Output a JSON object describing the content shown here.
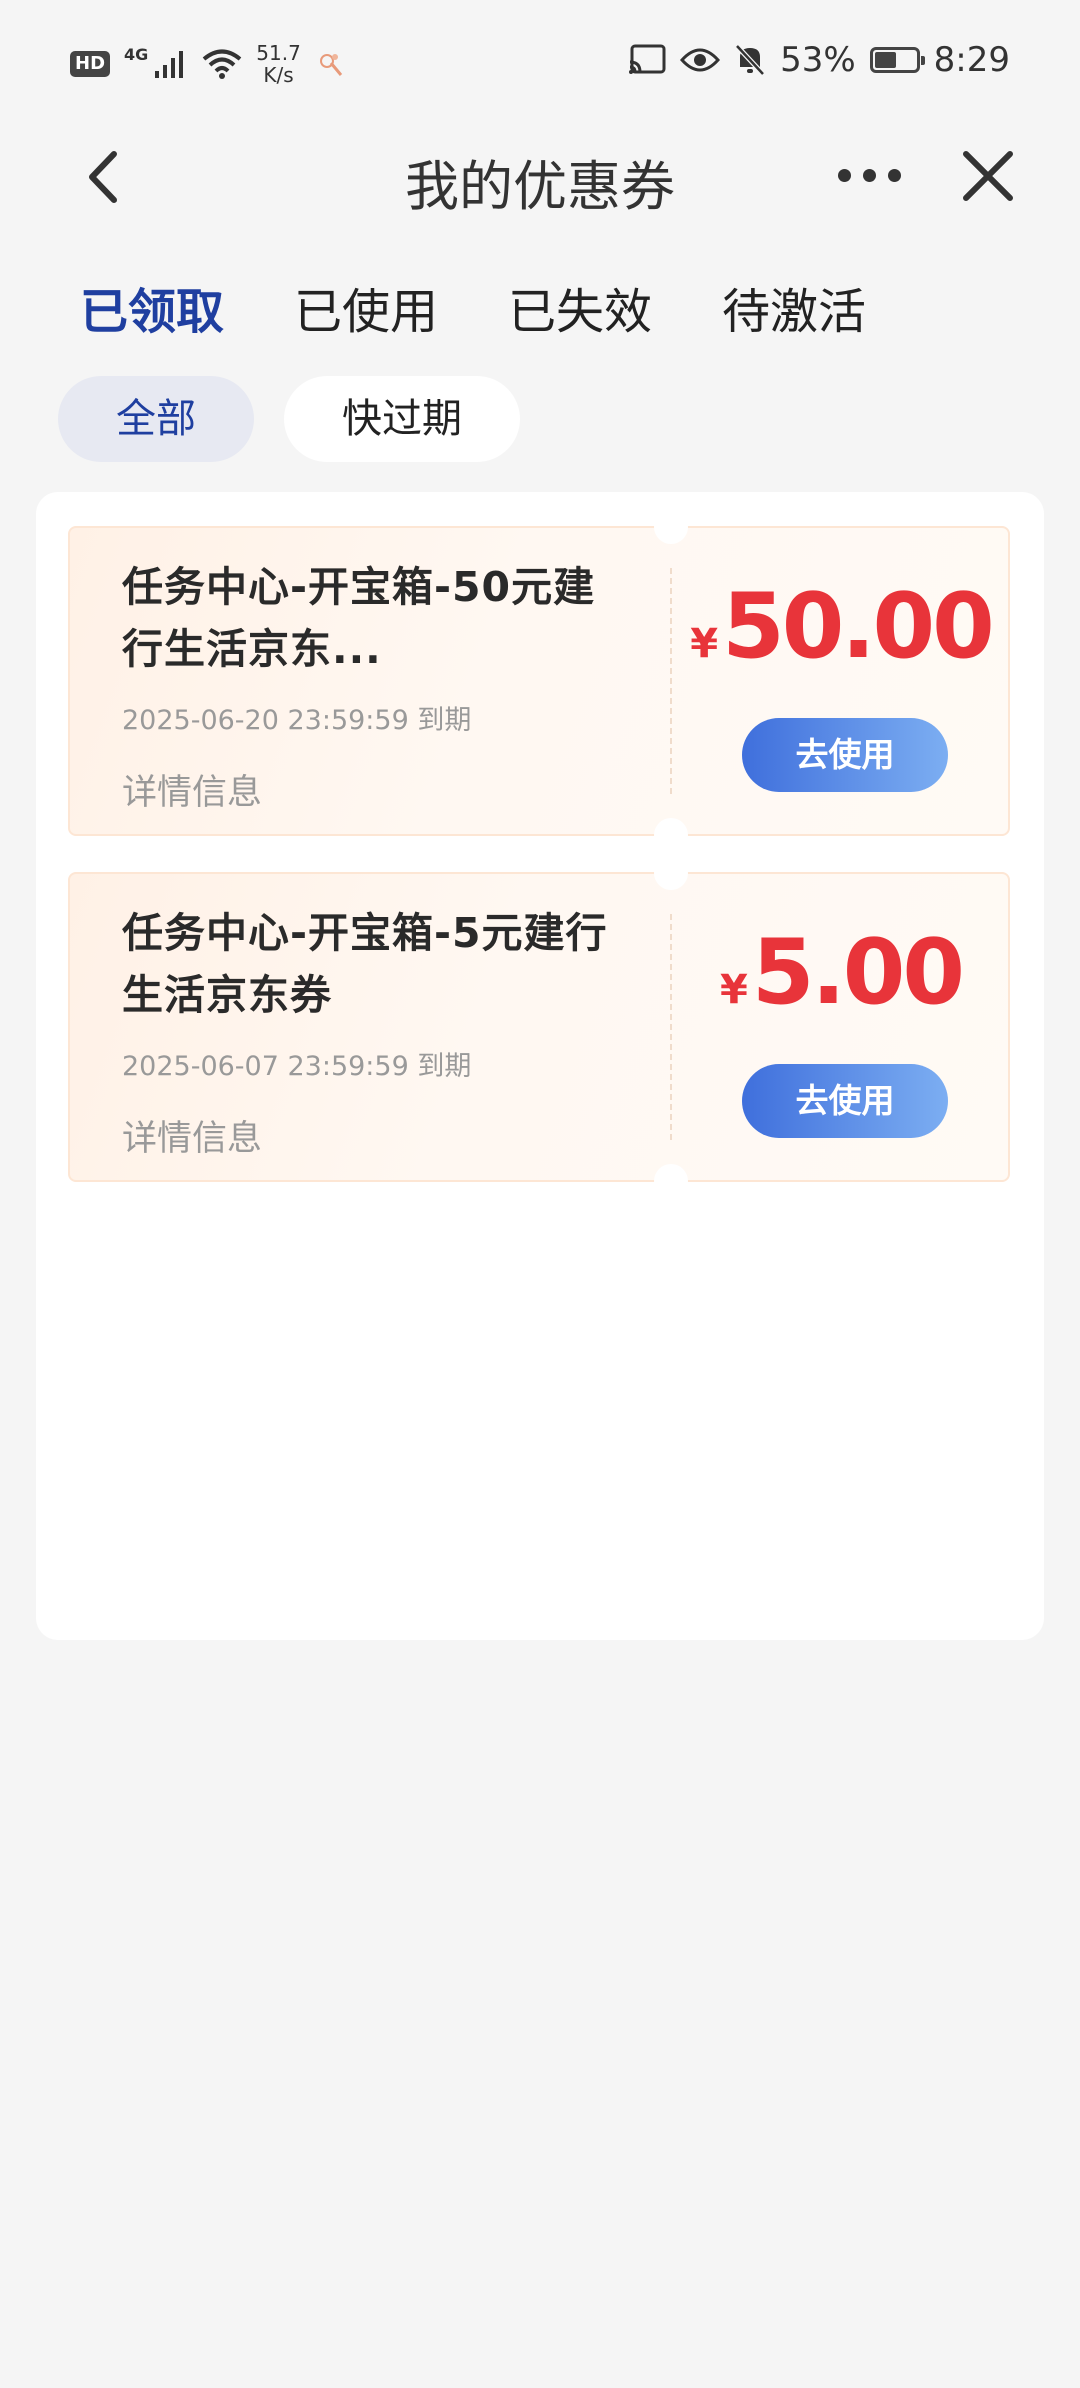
{
  "status_bar": {
    "hd": "HD",
    "network": "4G",
    "speed_value": "51.7",
    "speed_unit": "K/s",
    "battery_pct": "53%",
    "battery_level": 0.53,
    "time": "8:29"
  },
  "nav": {
    "back_icon": "chevron-left-icon",
    "title": "我的优惠券",
    "more_icon": "more-dots-icon",
    "close_icon": "close-icon"
  },
  "tabs": [
    {
      "label": "已领取",
      "active": true
    },
    {
      "label": "已使用",
      "active": false
    },
    {
      "label": "已失效",
      "active": false
    },
    {
      "label": "待激活",
      "active": false
    }
  ],
  "filters": [
    {
      "label": "全部",
      "active": true
    },
    {
      "label": "快过期",
      "active": false
    }
  ],
  "coupons": [
    {
      "title": "任务中心-开宝箱-50元建行生活京东...",
      "expire": "2025-06-20 23:59:59 到期",
      "detail": "详情信息",
      "currency": "¥",
      "amount": "50.00",
      "button": "去使用"
    },
    {
      "title": "任务中心-开宝箱-5元建行生活京东券",
      "expire": "2025-06-07 23:59:59 到期",
      "detail": "详情信息",
      "currency": "¥",
      "amount": "5.00",
      "button": "去使用"
    }
  ],
  "colors": {
    "accent": "#1f3fa0",
    "price": "#e8343a",
    "button_start": "#3f6fdc",
    "button_end": "#7caef2"
  }
}
